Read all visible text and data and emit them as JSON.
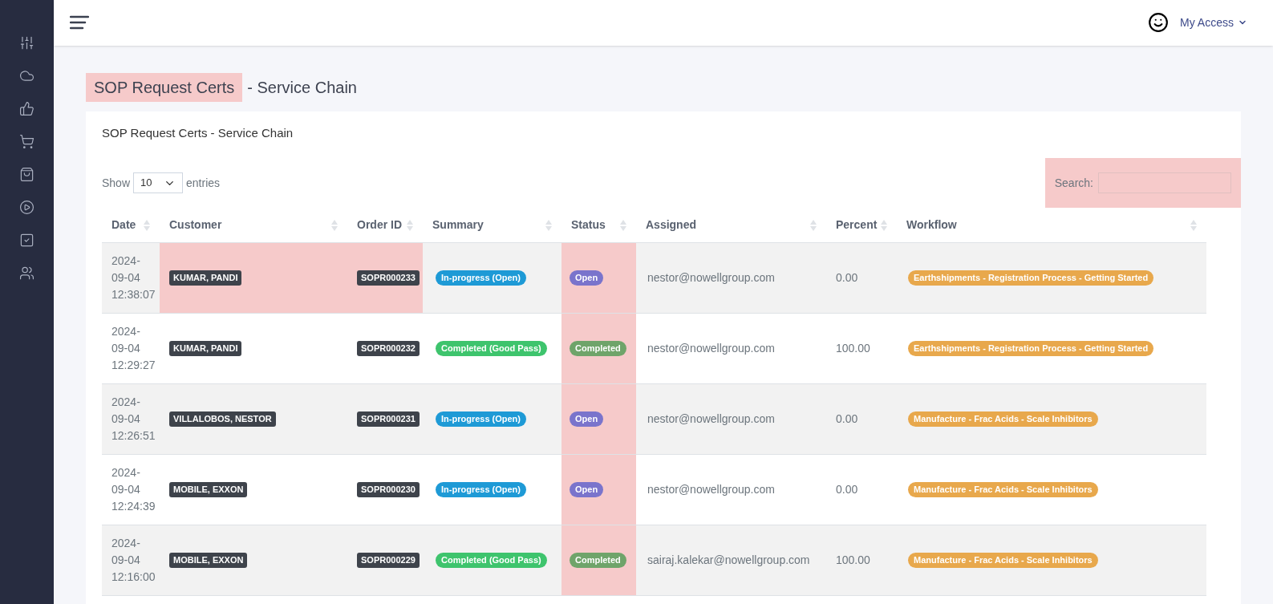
{
  "header": {
    "account_label": "My Access"
  },
  "page_title": {
    "highlighted_part": "SOP Request Certs",
    "rest": "- Service Chain",
    "highlighted": true
  },
  "card": {
    "title": "SOP Request Certs - Service Chain",
    "length_menu": {
      "before": "Show",
      "value": "10",
      "after": "entries"
    },
    "search": {
      "label": "Search:",
      "highlighted": true
    },
    "status_column_highlighted": true,
    "columns": [
      {
        "label": "Date"
      },
      {
        "label": "Customer"
      },
      {
        "label": "Order ID"
      },
      {
        "label": "Summary"
      },
      {
        "label": "Status"
      },
      {
        "label": "Assigned"
      },
      {
        "label": "Percent"
      },
      {
        "label": "Workflow"
      }
    ],
    "rows": [
      {
        "date": "2024-09-04 12:38:07",
        "customer": "KUMAR, PANDI",
        "order_id": "SOPR000233",
        "summary": {
          "text": "In-progress (Open)",
          "kind": "in_progress"
        },
        "status": {
          "text": "Open",
          "kind": "open"
        },
        "assigned": "nestor@nowellgroup.com",
        "percent": "0.00",
        "workflow": "Earthshipments - Registration Process - Getting Started",
        "highlighted": true
      },
      {
        "date": "2024-09-04 12:29:27",
        "customer": "KUMAR, PANDI",
        "order_id": "SOPR000232",
        "summary": {
          "text": "Completed (Good Pass)",
          "kind": "completed"
        },
        "status": {
          "text": "Completed",
          "kind": "completed"
        },
        "assigned": "nestor@nowellgroup.com",
        "percent": "100.00",
        "workflow": "Earthshipments - Registration Process - Getting Started",
        "highlighted": false
      },
      {
        "date": "2024-09-04 12:26:51",
        "customer": "VILLALOBOS, NESTOR",
        "order_id": "SOPR000231",
        "summary": {
          "text": "In-progress (Open)",
          "kind": "in_progress"
        },
        "status": {
          "text": "Open",
          "kind": "open"
        },
        "assigned": "nestor@nowellgroup.com",
        "percent": "0.00",
        "workflow": "Manufacture - Frac Acids - Scale Inhibitors",
        "highlighted": false
      },
      {
        "date": "2024-09-04 12:24:39",
        "customer": "MOBILE, EXXON",
        "order_id": "SOPR000230",
        "summary": {
          "text": "In-progress (Open)",
          "kind": "in_progress"
        },
        "status": {
          "text": "Open",
          "kind": "open"
        },
        "assigned": "nestor@nowellgroup.com",
        "percent": "0.00",
        "workflow": "Manufacture - Frac Acids - Scale Inhibitors",
        "highlighted": false
      },
      {
        "date": "2024-09-04 12:16:00",
        "customer": "MOBILE, EXXON",
        "order_id": "SOPR000229",
        "summary": {
          "text": "Completed (Good Pass)",
          "kind": "completed"
        },
        "status": {
          "text": "Completed",
          "kind": "completed"
        },
        "assigned": "sairaj.kalekar@nowellgroup.com",
        "percent": "100.00",
        "workflow": "Manufacture - Frac Acids - Scale Inhibitors",
        "highlighted": false
      }
    ]
  }
}
